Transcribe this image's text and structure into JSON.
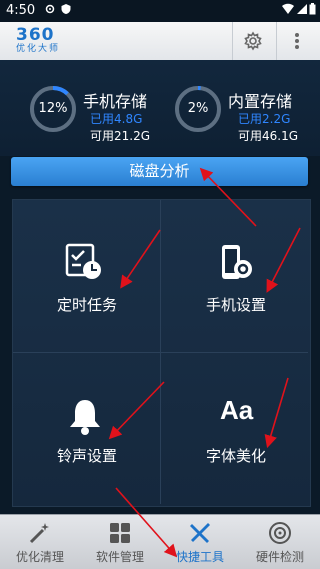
{
  "status_bar": {
    "time": "4:50"
  },
  "header": {
    "logo_number": "360",
    "logo_sub": "优化大师"
  },
  "storage": {
    "phone": {
      "title": "手机存储",
      "percent_label": "12%",
      "percent": 12,
      "used": "已用4.8G",
      "free": "可用21.2G"
    },
    "internal": {
      "title": "内置存储",
      "percent_label": "2%",
      "percent": 2,
      "used": "已用2.2G",
      "free": "可用46.1G"
    }
  },
  "analyze_button": "磁盘分析",
  "tools": [
    {
      "label": "定时任务",
      "icon": "scheduled-task-icon"
    },
    {
      "label": "手机设置",
      "icon": "phone-settings-icon"
    },
    {
      "label": "铃声设置",
      "icon": "bell-icon"
    },
    {
      "label": "字体美化",
      "icon": "font-aa-icon",
      "glyph": "Aa"
    }
  ],
  "bottom_nav": [
    {
      "label": "优化清理",
      "icon": "magic-wand-icon",
      "active": false
    },
    {
      "label": "软件管理",
      "icon": "apps-grid-icon",
      "active": false
    },
    {
      "label": "快捷工具",
      "icon": "tools-icon",
      "active": true
    },
    {
      "label": "硬件检测",
      "icon": "hardware-check-icon",
      "active": false
    }
  ],
  "colors": {
    "accent": "#2f86ff",
    "button": "#3a92e3",
    "annotation_arrow": "#e0121b",
    "background": "#0e2033"
  }
}
